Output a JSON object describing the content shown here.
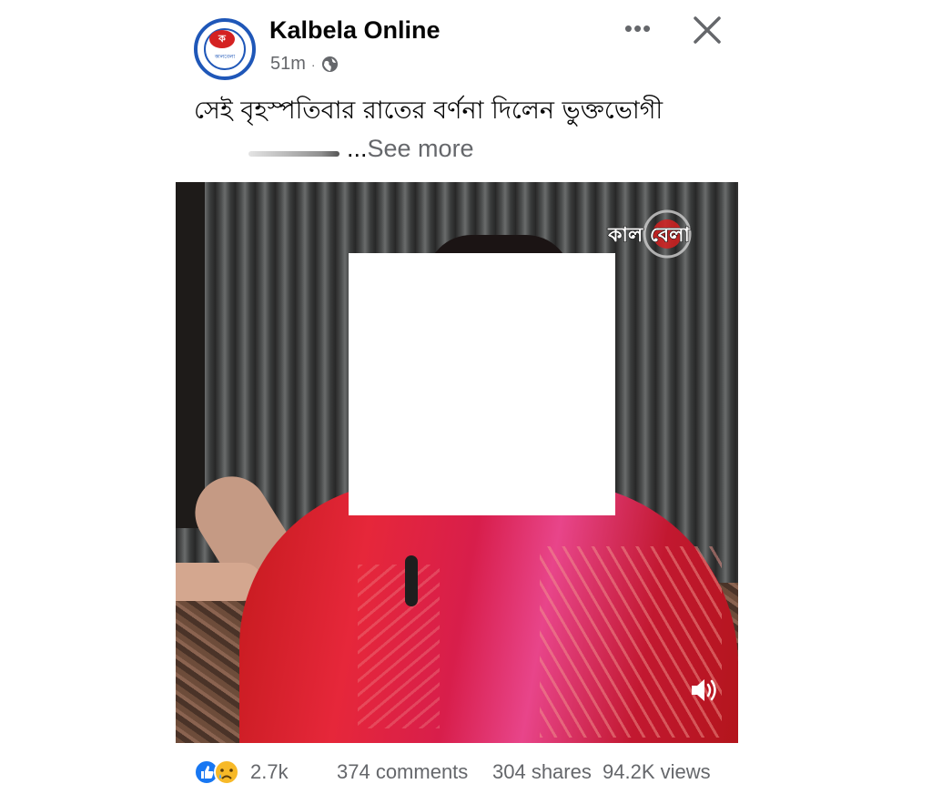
{
  "post": {
    "page_name": "Kalbela Online",
    "time": "51m",
    "separator": "·",
    "privacy_icon": "globe-icon",
    "avatar_logo_mark": "ক",
    "avatar_logo_text": "কালবেলা",
    "more_icon": "more-options-icon",
    "more_label": "•••",
    "close_icon": "close-icon",
    "caption_line1": "সেই বৃহস্পতিবার রাতের বর্ণনা দিলেন ভুক্তভোগী",
    "caption_truncated": "...",
    "see_more": "See more"
  },
  "video": {
    "watermark": "কাল বেলা",
    "sound_icon": "speaker-volume-icon"
  },
  "stats": {
    "reactions_icons": [
      "like-icon",
      "sad-icon"
    ],
    "reaction_count": "2.7k",
    "comments": "374 comments",
    "shares": "304 shares",
    "views": "94.2K views"
  },
  "colors": {
    "brand_blue": "#1f57b8",
    "brand_red": "#d42121",
    "secondary_text": "#65676b",
    "like_blue": "#1877f2",
    "sad_yellow": "#f7b928"
  }
}
